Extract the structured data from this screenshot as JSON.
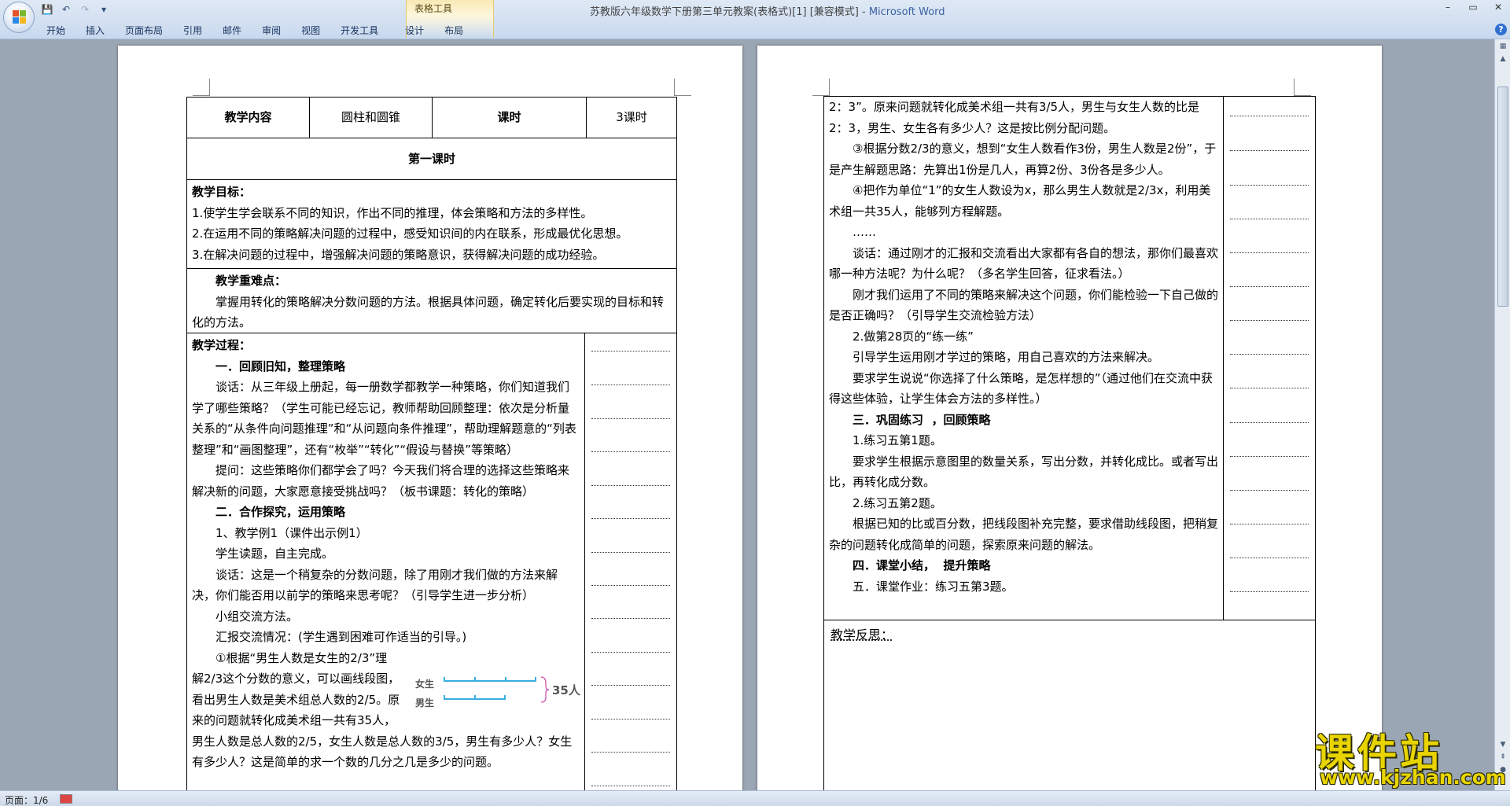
{
  "window": {
    "title_doc": "苏教版六年级数学下册第三单元教案(表格式)[1] [兼容模式]",
    "title_sep": " - ",
    "title_app": "Microsoft Word",
    "context_group": "表格工具",
    "controls": {
      "minimize": "–",
      "restore": "▭",
      "close": "✕"
    }
  },
  "qat": {
    "save": "💾",
    "undo": "↶",
    "redo": "↷",
    "more": "▾"
  },
  "ribbon": {
    "tabs": [
      "开始",
      "插入",
      "页面布局",
      "引用",
      "邮件",
      "审阅",
      "视图",
      "开发工具",
      "设计",
      "布局"
    ],
    "help": "?"
  },
  "page1": {
    "header": [
      "教学内容",
      "圆柱和圆锥",
      "课时",
      "3课时"
    ],
    "lesson_title": "第一课时",
    "goals": [
      "教学目标：",
      "1.使学生学会联系不同的知识，作出不同的推理，体会策略和方法的多样性。",
      "2.在运用不同的策略解决问题的过程中，感受知识间的内在联系，形成最优化思想。",
      "3.在解决问题的过程中，增强解决问题的策略意识，获得解决问题的成功经验。"
    ],
    "key_title": "教学重难点：",
    "key_text": "掌握用转化的策略解决分数问题的方法。根据具体问题，确定转化后要实现的目标和转化的方法。",
    "process": [
      "教学过程：",
      "一．回顾旧知，整理策略",
      "谈话：从三年级上册起，每一册数学都教学一种策略，你们知道我们学了哪些策略？（学生可能已经忘记，教师帮助回顾整理：依次是分析量关系的“从条件向问题推理”和“从问题向条件推理”，帮助理解题意的“列表整理”和“画图整理”，还有“枚举”“转化”“假设与替换”等策略）",
      "提问：这些策略你们都学会了吗？今天我们将合理的选择这些策略来解决新的问题，大家愿意接受挑战吗？（板书课题：转化的策略）",
      "二．合作探究，运用策略",
      "1、教学例1（课件出示例1）",
      "学生读题，自主完成。",
      "谈话：这是一个稍复杂的分数问题，除了用刚才我们做的方法来解决，你们能否用以前学的策略来思考呢？（引导学生进一步分析）",
      "小组交流方法。",
      "汇报交流情况：(学生遇到困难可作适当的引导。)",
      "①根据“男生人数是女生的2/3”理",
      "解2/3这个分数的意义，可以画线段图，",
      "看出男生人数是美术组总人数的2/5。原",
      "来的问题就转化成美术组一共有35人，",
      "男生人数是总人数的2/5，女生人数是总人数的3/5，男生有多少人？女生有多少人？这是简单的求一个数的几分之几是多少的问题。"
    ],
    "diagram": {
      "female": "女生",
      "male": "男生",
      "total": "35人"
    }
  },
  "page2": {
    "lines": [
      "2：3”。原来问题就转化成美术组一共有3/5人，男生与女生人数的比是2：3，男生、女生各有多少人？这是按比例分配问题。",
      "③根据分数2/3的意义，想到“女生人数看作3份，男生人数是2份”，于是产生解题思路：先算出1份是几人，再算2份、3份各是多少人。",
      "④把作为单位“1”的女生人数设为x，那么男生人数就是2/3x，利用美术组一共35人，能够列方程解题。",
      "……",
      "谈话：通过刚才的汇报和交流看出大家都有各自的想法，那你们最喜欢哪一种方法呢？为什么呢？（多名学生回答，征求看法。）",
      "刚才我们运用了不同的策略来解决这个问题，你们能检验一下自己做的是否正确吗？（引导学生交流检验方法）",
      "2.做第28页的“练一练”",
      "引导学生运用刚才学过的策略，用自己喜欢的方法来解决。",
      "要求学生说说“你选择了什么策略，是怎样想的”（通过他们在交流中获得这些体验，让学生体会方法的多样性。）",
      "三．巩固练习  ，回顾策略",
      "1.练习五第1题。",
      "要求学生根据示意图里的数量关系，写出分数，并转化成比。或者写出比，再转化成分数。",
      "2.练习五第2题。",
      "根据已知的比或百分数，把线段图补充完整，要求借助线段图，把稍复杂的问题转化成简单的问题，探索原来问题的解法。",
      "四．课堂小结，  提升策略",
      "五．课堂作业：练习五第3题。"
    ],
    "reflection": "教学反思："
  },
  "status": {
    "page": "页面：1/6"
  },
  "watermark": {
    "title": "课件站",
    "url": "www.kjzhan.com"
  },
  "colors": {
    "accent": "#3a5fa0",
    "workspace": "#9aa6b4",
    "watermark": "#e8d400"
  }
}
